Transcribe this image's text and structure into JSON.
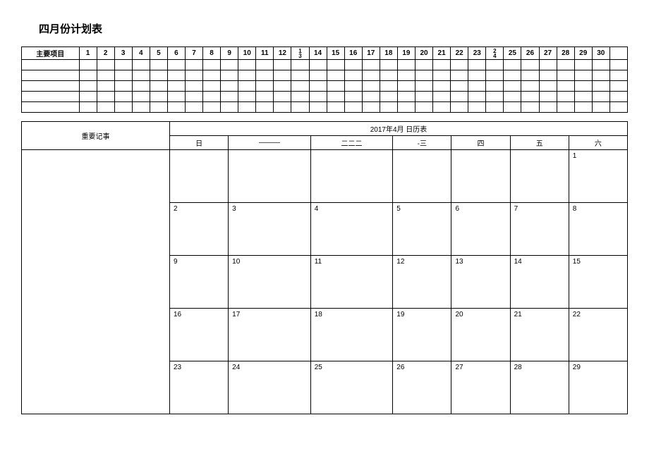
{
  "title": "四月份计划表",
  "schedule": {
    "rowLabel": "主要项目",
    "days": [
      "1",
      "2",
      "3",
      "4",
      "5",
      "6",
      "7",
      "8",
      "9",
      "10",
      "11",
      "12",
      "13",
      "14",
      "15",
      "16",
      "17",
      "18",
      "19",
      "20",
      "21",
      "22",
      "23",
      "24",
      "25",
      "26",
      "27",
      "28",
      "29",
      "30"
    ],
    "stackIndices": [
      12,
      23
    ],
    "emptyRows": 5
  },
  "calendar": {
    "notesLabel": "重要记事",
    "monthTitle": "2017年4月 日历表",
    "dow": [
      "日",
      "———",
      "二二二",
      "-三",
      "四",
      "五",
      "六"
    ],
    "weeks": [
      [
        "",
        "",
        "",
        "",
        "",
        "",
        "1"
      ],
      [
        "2",
        "3",
        "4",
        "5",
        "6",
        "7",
        "8"
      ],
      [
        "9",
        "10",
        "11",
        "12",
        "13",
        "14",
        "15"
      ],
      [
        "16",
        "17",
        "18",
        "19",
        "20",
        "21",
        "22"
      ],
      [
        "23",
        "24",
        "25",
        "26",
        "27",
        "28",
        "29"
      ]
    ]
  }
}
